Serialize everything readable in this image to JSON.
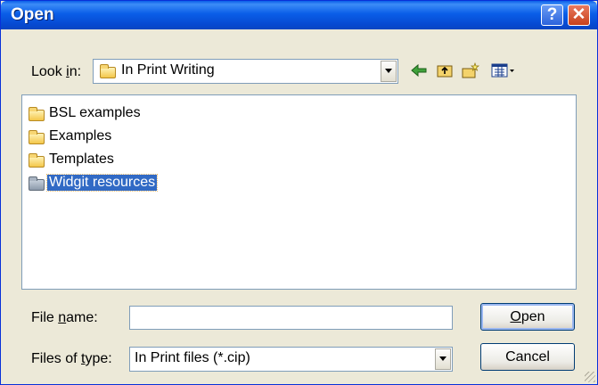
{
  "window": {
    "title": "Open"
  },
  "titlebar": {
    "help_glyph": "?",
    "close_glyph": "✕"
  },
  "look_in": {
    "label_before": "Look ",
    "label_accel": "i",
    "label_after": "n:",
    "value": "In Print Writing"
  },
  "toolbar": {
    "back_icon": "back-arrow-icon",
    "up_icon": "up-folder-icon",
    "new_folder_icon": "new-folder-icon",
    "views_icon": "views-menu-icon"
  },
  "files": [
    {
      "name": "BSL examples",
      "selected": false
    },
    {
      "name": "Examples",
      "selected": false
    },
    {
      "name": "Templates",
      "selected": false
    },
    {
      "name": "Widgit resources",
      "selected": true
    }
  ],
  "file_name": {
    "label_before": "File ",
    "label_accel": "n",
    "label_after": "ame:",
    "value": ""
  },
  "file_type": {
    "label_before": "Files of ",
    "label_accel": "t",
    "label_after": "ype:",
    "value": "In Print files (*.cip)"
  },
  "buttons": {
    "open_accel": "O",
    "open_rest": "pen",
    "cancel": "Cancel"
  },
  "colors": {
    "selection": "#316ac5",
    "titlebar": "#0a5ee8",
    "dialog_bg": "#ece9d8"
  }
}
